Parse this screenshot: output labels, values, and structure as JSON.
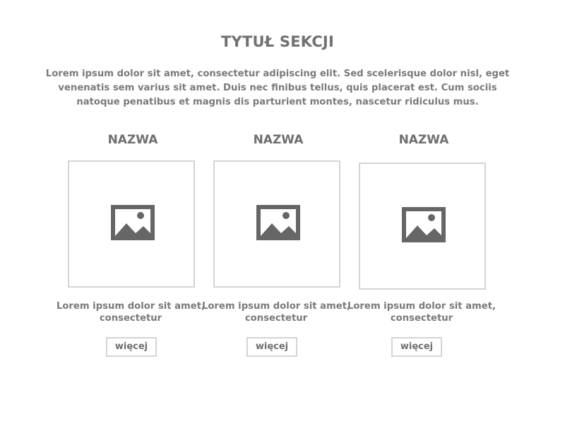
{
  "section": {
    "title": "TYTUŁ SEKCJI",
    "description": "Lorem ipsum dolor sit amet, consectetur adipiscing elit. Sed scelerisque dolor nisl, eget venenatis sem varius sit amet. Duis nec finibus tellus, quis placerat est. Cum sociis natoque penatibus et magnis dis parturient montes, nascetur ridiculus mus."
  },
  "cards": [
    {
      "name": "NAZWA",
      "image_icon": "image-placeholder-icon",
      "text": "Lorem ipsum dolor sit amet, consectetur",
      "button_label": "więcej"
    },
    {
      "name": "NAZWA",
      "image_icon": "image-placeholder-icon",
      "text": "Lorem ipsum dolor sit amet, consectetur",
      "button_label": "więcej"
    },
    {
      "name": "NAZWA",
      "image_icon": "image-placeholder-icon",
      "text": "Lorem ipsum dolor sit amet, consectetur",
      "button_label": "więcej"
    }
  ],
  "colors": {
    "text": "#6f6f6f",
    "border": "#d4d4d4",
    "icon": "#666666"
  }
}
